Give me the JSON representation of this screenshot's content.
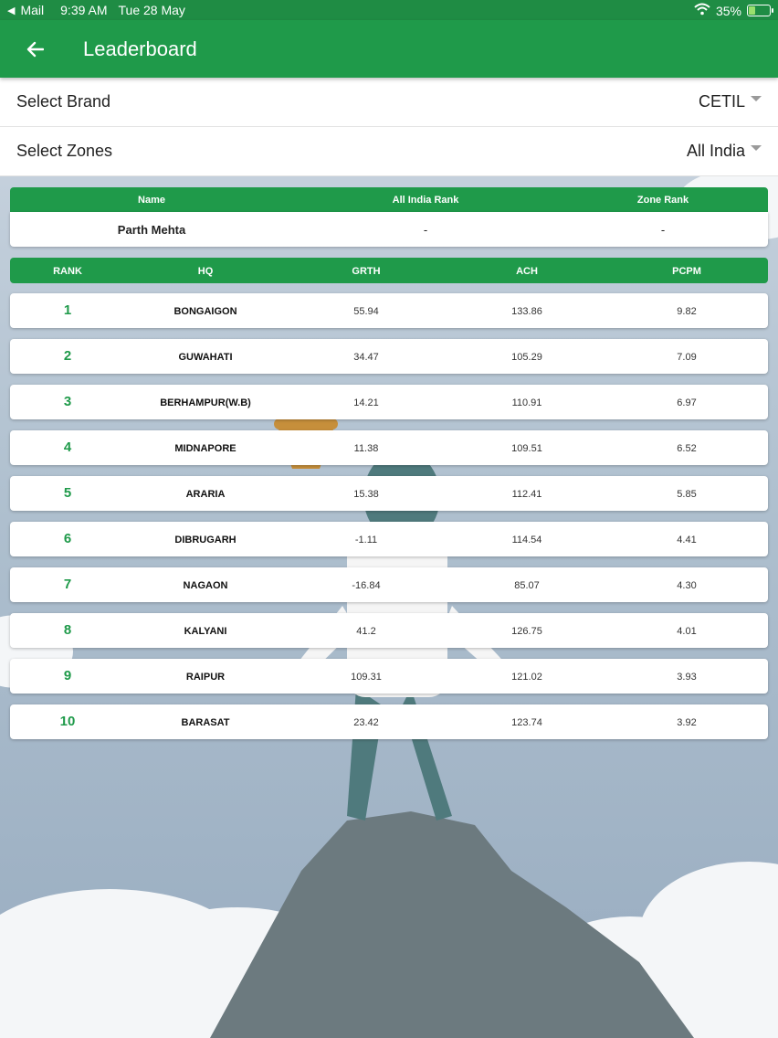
{
  "status_bar": {
    "back_app": "Mail",
    "time": "9:39 AM",
    "date": "Tue 28 May",
    "battery": "35%",
    "battery_level": 0.35
  },
  "header": {
    "title": "Leaderboard"
  },
  "filters": {
    "brand_label": "Select Brand",
    "brand_value": "CETIL",
    "zone_label": "Select Zones",
    "zone_value": "All India"
  },
  "user_summary": {
    "headers": [
      "Name",
      "All India Rank",
      "Zone Rank"
    ],
    "name": "Parth Mehta",
    "all_india_rank": "-",
    "zone_rank": "-"
  },
  "leaderboard": {
    "headers": [
      "RANK",
      "HQ",
      "GRTH",
      "ACH",
      "PCPM"
    ],
    "rows": [
      {
        "rank": "1",
        "hq": "BONGAIGON",
        "grth": "55.94",
        "ach": "133.86",
        "pcpm": "9.82"
      },
      {
        "rank": "2",
        "hq": "GUWAHATI",
        "grth": "34.47",
        "ach": "105.29",
        "pcpm": "7.09"
      },
      {
        "rank": "3",
        "hq": "BERHAMPUR(W.B)",
        "grth": "14.21",
        "ach": "110.91",
        "pcpm": "6.97"
      },
      {
        "rank": "4",
        "hq": "MIDNAPORE",
        "grth": "11.38",
        "ach": "109.51",
        "pcpm": "6.52"
      },
      {
        "rank": "5",
        "hq": "ARARIA",
        "grth": "15.38",
        "ach": "112.41",
        "pcpm": "5.85"
      },
      {
        "rank": "6",
        "hq": "DIBRUGARH",
        "grth": "-1.11",
        "ach": "114.54",
        "pcpm": "4.41"
      },
      {
        "rank": "7",
        "hq": "NAGAON",
        "grth": "-16.84",
        "ach": "85.07",
        "pcpm": "4.30"
      },
      {
        "rank": "8",
        "hq": "KALYANI",
        "grth": "41.2",
        "ach": "126.75",
        "pcpm": "4.01"
      },
      {
        "rank": "9",
        "hq": "RAIPUR",
        "grth": "109.31",
        "ach": "121.02",
        "pcpm": "3.93"
      },
      {
        "rank": "10",
        "hq": "BARASAT",
        "grth": "23.42",
        "ach": "123.74",
        "pcpm": "3.92"
      }
    ]
  },
  "colors": {
    "primary": "#1f9a4a",
    "status_bar": "#1f8c44",
    "rank_text": "#1f9a4a"
  },
  "icons": {
    "back": "arrow-left-icon",
    "dropdown": "caret-down-icon",
    "wifi": "wifi-icon",
    "battery": "battery-charging-icon"
  }
}
